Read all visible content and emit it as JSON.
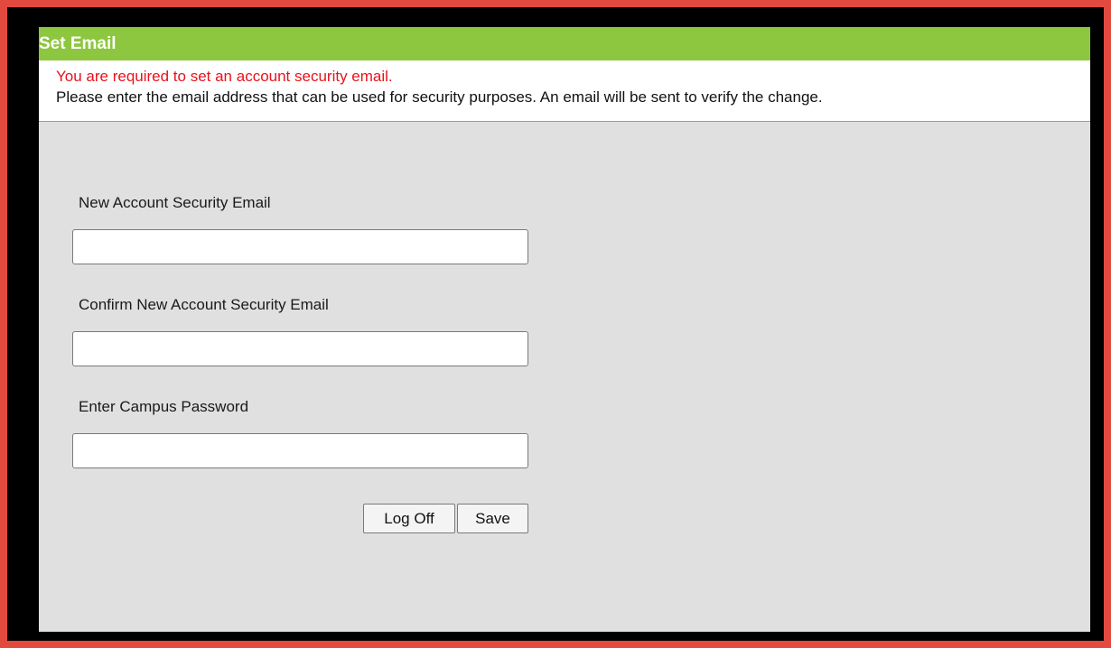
{
  "dialog": {
    "title": "Set Email",
    "warning": "You are required to set an account security email.",
    "instructions": "Please enter the email address that can be used for security purposes. An email will be sent to verify the change."
  },
  "form": {
    "new_email_label": "New Account Security Email",
    "new_email_value": "",
    "confirm_email_label": "Confirm New Account Security Email",
    "confirm_email_value": "",
    "password_label": "Enter Campus Password",
    "password_value": ""
  },
  "buttons": {
    "log_off": "Log Off",
    "save": "Save"
  },
  "colors": {
    "title_bar": "#8dc63f",
    "warning_text": "#e8121b",
    "panel_background": "#e0e0e0",
    "frame": "#000000",
    "page_background": "#e24a40"
  }
}
